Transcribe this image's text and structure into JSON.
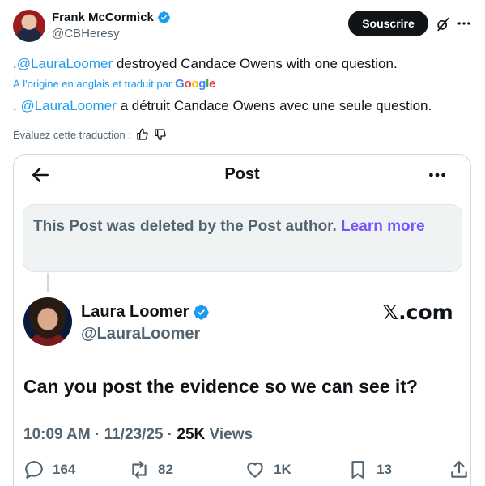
{
  "tweet": {
    "author_name": "Frank McCormick",
    "author_handle": "@CBHeresy",
    "subscribe_label": "Souscrire",
    "text_prefix": ".",
    "text_mention": "@LauraLoomer",
    "text_rest": " destroyed Candace Owens with one question.",
    "translated_by": "À l'origine en anglais et traduit par",
    "translation_prefix": ". ",
    "translation_mention": "@LauraLoomer",
    "translation_rest": " a détruit Candace Owens avec une seule question.",
    "rate_label": "Évaluez cette traduction :"
  },
  "card": {
    "title": "Post",
    "deleted_text": "This Post was deleted by the Post author.",
    "learn_more": "Learn more",
    "quote_name": "Laura Loomer",
    "quote_handle": "@LauraLoomer",
    "watermark": "𝕏.com",
    "quote_text": "Can you post the evidence so we can see it?",
    "time": "10:09 AM · 11/23/25 · ",
    "views_count": "25K",
    "views_label": "Views",
    "replies": "164",
    "reposts": "82",
    "likes": "1K",
    "bookmarks": "13"
  },
  "colors": {
    "accent": "#1d9bf0",
    "learn_more": "#7856ff",
    "muted": "#536471"
  }
}
